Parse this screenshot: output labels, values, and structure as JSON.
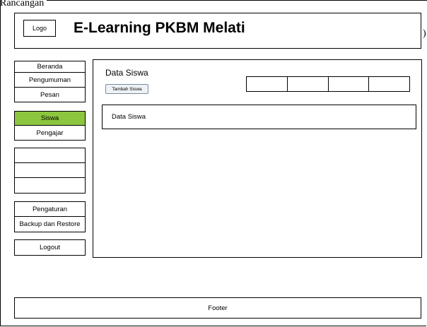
{
  "caption": "Rancangan Tampilan",
  "header": {
    "logo": "Logo",
    "title": "E-Learning PKBM Melati"
  },
  "sidebar": {
    "group1": [
      "Beranda",
      "Pengumuman",
      "Pesan"
    ],
    "group2": [
      "Siswa",
      "Pengajar"
    ],
    "group2_active": "Siswa",
    "group3": [
      "",
      "",
      ""
    ],
    "group4": [
      "Pengaturan",
      "Backup dan Restore"
    ],
    "logout": "Logout"
  },
  "main": {
    "title": "Data Siswa",
    "add_button": "Tambah Siswa",
    "tabs": [
      "",
      "",
      "",
      ""
    ],
    "panel_label": "Data Siswa"
  },
  "footer": {
    "label": "Footer"
  },
  "colors": {
    "active_nav": "#8cc63f",
    "border": "#000000"
  }
}
